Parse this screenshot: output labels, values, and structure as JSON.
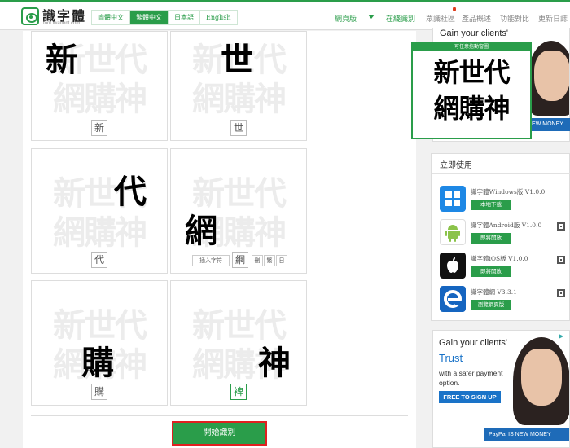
{
  "brand": {
    "name": "識字體",
    "domain": "font.iwatfont.com",
    "accent": "#2a9d4a"
  },
  "languages": [
    "簡體中文",
    "繁體中文",
    "日本語",
    "English"
  ],
  "active_language": "繁體中文",
  "nav": {
    "web_version": "網頁版",
    "online_recognition": "在綫識別",
    "social": "眾識社區",
    "overview": "產品概述",
    "compare": "功能對比",
    "changelog": "更新日誌"
  },
  "preview": {
    "line1": "新世代",
    "line2": "網購神"
  },
  "cards": [
    {
      "glyph": "新",
      "label": "新",
      "selected": false
    },
    {
      "glyph": "世",
      "label": "世",
      "selected": false
    },
    {
      "glyph": "代",
      "label": "代",
      "selected": false
    },
    {
      "glyph": "網",
      "label": "網",
      "selected": false,
      "insert_label": "插入字符",
      "options": [
        "刪",
        "繁",
        "日"
      ]
    },
    {
      "glyph": "購",
      "label": "購",
      "selected": false
    },
    {
      "glyph": "神",
      "label": "神",
      "selected": true,
      "display_label": "裨"
    }
  ],
  "start_button": "開始識別",
  "ad_top": {
    "headline": "Gain your clients'",
    "popup_caption": "可任意拖動窗圖",
    "popup_line1": "新世代",
    "popup_line2": "網購神",
    "badge": "NEW MONEY"
  },
  "use_now": {
    "title": "立即使用",
    "apps": [
      {
        "name": "識字體Windows版 V1.0.0",
        "action": "本地下載",
        "icon": "windows-icon",
        "qr": false
      },
      {
        "name": "識字體Android版 V1.0.0",
        "action": "即將開放",
        "icon": "android-icon",
        "qr": true
      },
      {
        "name": "識字體iOS版 V1.0.0",
        "action": "即將開放",
        "icon": "apple-icon",
        "qr": true
      },
      {
        "name": "識字體網 V3.3.1",
        "action": "瀏覽網頁版",
        "icon": "edge-icon",
        "qr": true
      }
    ]
  },
  "ad_bottom": {
    "headline": "Gain your clients'",
    "trust": "Trust",
    "sub": "with a safer payment option.",
    "cta": "FREE TO SIGN UP",
    "paypal": "PayPal IS NEW MONEY"
  }
}
